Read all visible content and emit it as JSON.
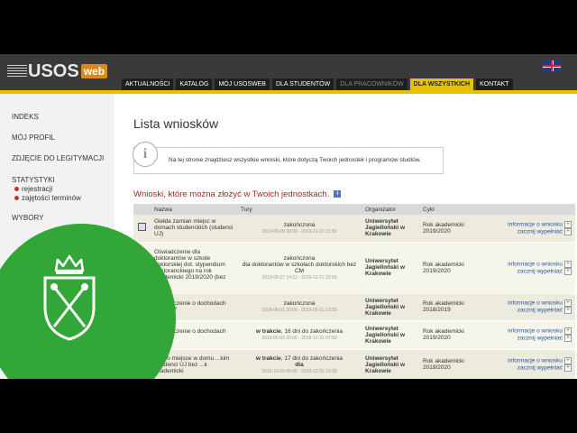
{
  "header": {
    "logo_text": "USOS",
    "logo_badge": "web",
    "flag_icon": "uk-flag-icon",
    "nav": [
      "AKTUALNOŚCI",
      "KATALOG",
      "MÓJ USOSWEB",
      "DLA STUDENTÓW",
      "DLA PRACOWNIKÓW",
      "DLA WSZYSTKICH",
      "KONTAKT"
    ],
    "active_tab": "DLA WSZYSTKICH"
  },
  "sidebar": {
    "items": [
      "INDEKS",
      "MÓJ PROFIL",
      "ZDJĘCIE DO LEGITYMACJI",
      "STATYSTYKI",
      "WYBORY"
    ],
    "sub_items": [
      "rejestracji",
      "zajętości terminów"
    ]
  },
  "main": {
    "title": "Lista wniosków",
    "info_text": "Na tej stronie znajdziesz wszystkie wnioski, które dotyczą Twoich jednostek i programów studiów.",
    "section_title": "Wnioski, które można złożyć w Twoich jednostkach.",
    "table": {
      "headers": [
        "",
        "Nazwa",
        "Tury",
        "Organizator",
        "Cykl",
        ""
      ],
      "rows": [
        {
          "name": "Giełda zamian miejsc w domach studenckich (studenci UJ)",
          "status": "zakończona",
          "status_prefix": "",
          "status_bold": "",
          "detail": "",
          "dates": "2019-09-09 00:00 - 2019-11-22 23:59",
          "org": "Uniwersytet Jagielloński w Krakowie",
          "cycle": "Rok akademicki 2019/2020",
          "link1": "informacje o wniosku",
          "link2": "zacznij wypełniać"
        },
        {
          "name": "Oświadczenie dla doktorantów w szkole doktorskiej dot. stypendium doktoranckiego na rok akademicki 2019/2020 (bez CM)",
          "status": "zakończona",
          "status_prefix": "",
          "status_bold": "",
          "detail": "dla doktorantów w szkołach doktorskich bez CM",
          "dates": "2019-09-27 14:12 - 2019-11-21 23:59",
          "org": "Uniwersytet Jagielloński w Krakowie",
          "cycle": "Rok akademicki 2019/2020",
          "link1": "informacje o wniosku",
          "link2": "zacznij wypełniać"
        },
        {
          "name": "Oświadczenie o dochodach rok 2017",
          "status": "zakończona",
          "status_prefix": "",
          "status_bold": "",
          "detail": "",
          "dates": "2018-06-01 20:00 - 2019-05-31 23:59",
          "org": "Uniwersytet Jagielloński w Krakowie",
          "cycle": "Rok akademicki 2018/2019",
          "link1": "informacje o wniosku",
          "link2": "zacznij wypełniać"
        },
        {
          "name": "Oświadczenie o dochodach 2018",
          "status": ", 16 dni do zakończenia",
          "status_prefix": "",
          "status_bold": "w trakcie",
          "detail": "",
          "dates": "2019-06-03 20:00 - 2019-12-31 07:59",
          "org": "Uniwersytet Jagielloński w Krakowie",
          "cycle": "Rok akademicki 2019/2020",
          "link1": "informacje o wniosku",
          "link2": "zacznij wypełniać"
        },
        {
          "name": "...ek o miejsce w domu ...kim (studenci UJ bez ...k akademicki",
          "status": ", 17 dni do zakończenia",
          "status_prefix": "",
          "status_bold": "w trakcie",
          "detail": "dla",
          "dates": "2019-10-28 00:00 - 2019-12-31 19:30",
          "org": "Uniwersytet Jagielloński w Krakowie",
          "cycle": "Rok akademicki 2019/2020",
          "link1": "informacje o wniosku",
          "link2": "zacznij wypełniać"
        }
      ]
    }
  },
  "overlay": {
    "emblem_icon": "uj-crest-crown-scepters-icon",
    "color": "#33a638"
  }
}
